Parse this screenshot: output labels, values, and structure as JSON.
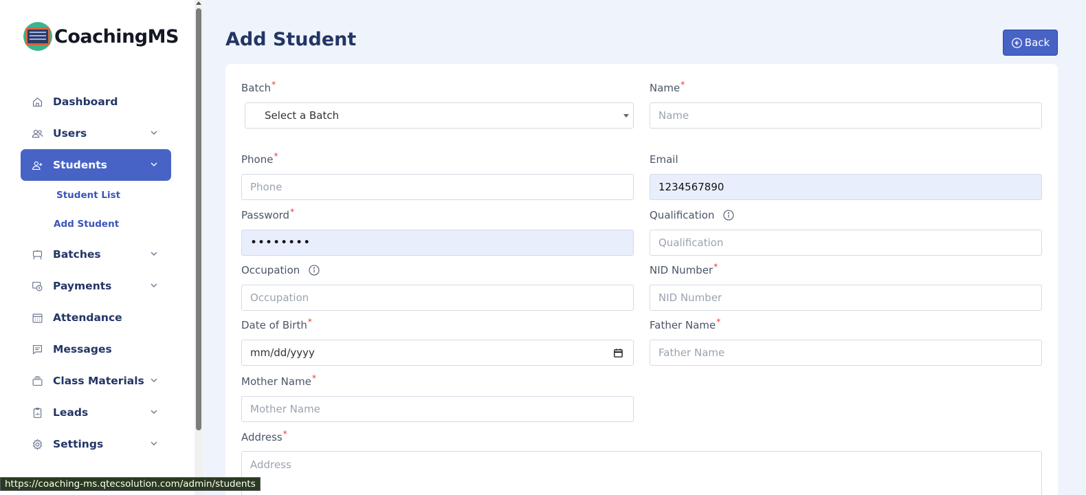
{
  "app": {
    "logo_text": "CoachingMS"
  },
  "sidebar": {
    "items": [
      {
        "label": "Dashboard",
        "icon": "home-icon",
        "has_chevron": false
      },
      {
        "label": "Users",
        "icon": "users-icon",
        "has_chevron": true
      },
      {
        "label": "Students",
        "icon": "user-plus-icon",
        "has_chevron": true,
        "active": true
      },
      {
        "label": "Batches",
        "icon": "easel-icon",
        "has_chevron": true
      },
      {
        "label": "Payments",
        "icon": "payment-icon",
        "has_chevron": true
      },
      {
        "label": "Attendance",
        "icon": "calendar-icon",
        "has_chevron": false
      },
      {
        "label": "Messages",
        "icon": "message-icon",
        "has_chevron": false
      },
      {
        "label": "Class Materials",
        "icon": "stack-icon",
        "has_chevron": true
      },
      {
        "label": "Leads",
        "icon": "clipboard-icon",
        "has_chevron": true
      },
      {
        "label": "Settings",
        "icon": "gear-icon",
        "has_chevron": true
      }
    ],
    "students_sub": [
      {
        "label": "Student List"
      },
      {
        "label": "Add Student"
      }
    ]
  },
  "page": {
    "title": "Add Student",
    "back_label": "Back"
  },
  "form": {
    "batch": {
      "label": "Batch",
      "value": "Select a Batch"
    },
    "name": {
      "label": "Name",
      "placeholder": "Name"
    },
    "phone": {
      "label": "Phone",
      "placeholder": "Phone"
    },
    "email": {
      "label": "Email",
      "value": "1234567890"
    },
    "password": {
      "label": "Password",
      "value": "••••••••"
    },
    "qualification": {
      "label": "Qualification",
      "placeholder": "Qualification"
    },
    "occupation": {
      "label": "Occupation",
      "placeholder": "Occupation"
    },
    "nid": {
      "label": "NID Number",
      "placeholder": "NID Number"
    },
    "dob": {
      "label": "Date of Birth",
      "value": "mm/dd/yyyy"
    },
    "father": {
      "label": "Father Name",
      "placeholder": "Father Name"
    },
    "mother": {
      "label": "Mother Name",
      "placeholder": "Mother Name"
    },
    "address": {
      "label": "Address",
      "placeholder": "Address"
    },
    "required_mark": "*"
  },
  "status_bar": {
    "url": "https://coaching-ms.qtecsolution.com/admin/students"
  },
  "colors": {
    "primary": "#4763c6",
    "background": "#eff4fc",
    "required": "#ee3333"
  }
}
